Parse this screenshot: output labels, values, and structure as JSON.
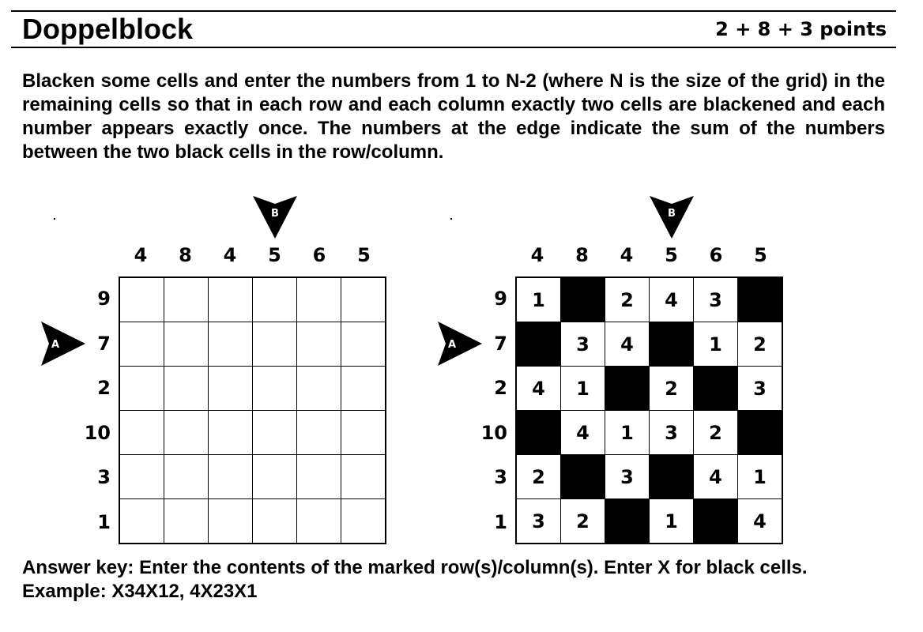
{
  "header": {
    "title": "Doppelblock",
    "points": "2 + 8  + 3 points"
  },
  "instructions": "Blacken some cells and enter the numbers from 1 to N-2 (where N is the size of the grid) in the remaining cells so that in each row and each column exactly two cells are blackened and each number appears exactly once. The numbers at the edge indicate the sum of the numbers between the two black cells in the row/column.",
  "markers": {
    "column_label": "B",
    "row_label": "A",
    "column_marker_index": 3,
    "row_marker_index": 1
  },
  "puzzle": {
    "col_clues": [
      "4",
      "8",
      "4",
      "5",
      "6",
      "5"
    ],
    "row_clues": [
      "9",
      "7",
      "2",
      "10",
      "3",
      "1"
    ]
  },
  "solution": {
    "grid": [
      [
        "1",
        "X",
        "2",
        "4",
        "3",
        "X"
      ],
      [
        "X",
        "3",
        "4",
        "X",
        "1",
        "2"
      ],
      [
        "4",
        "1",
        "X",
        "2",
        "X",
        "3"
      ],
      [
        "X",
        "4",
        "1",
        "3",
        "2",
        "X"
      ],
      [
        "2",
        "X",
        "3",
        "X",
        "4",
        "1"
      ],
      [
        "3",
        "2",
        "X",
        "1",
        "X",
        "4"
      ]
    ]
  },
  "answer_key": {
    "line1": "Answer key: Enter the contents of the marked row(s)/column(s). Enter X for black cells.",
    "line2": "Example: X34X12, 4X23X1"
  }
}
